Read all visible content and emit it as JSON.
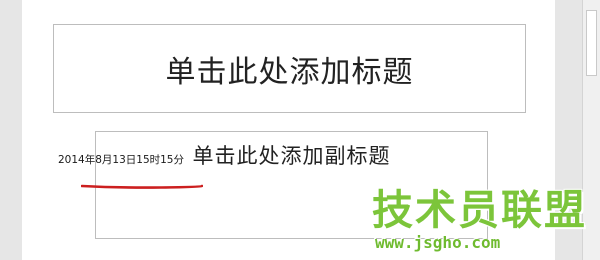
{
  "slide": {
    "title_placeholder": "单击此处添加标题",
    "subtitle_placeholder": "单击此处添加副标题",
    "date_text": "2014年8月13日15时15分"
  },
  "annotation": {
    "underline_color": "#cc1f1f"
  },
  "watermark": {
    "brand": "技术员联盟",
    "url": "www.jsgho.com",
    "color": "#7cc53a"
  }
}
